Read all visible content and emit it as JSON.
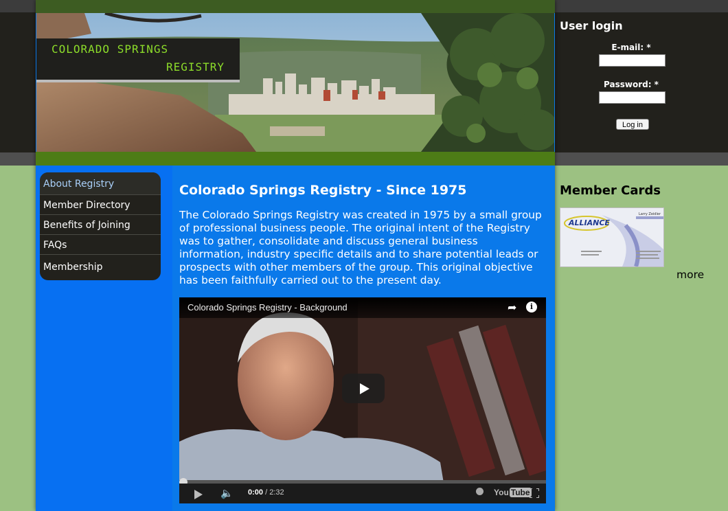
{
  "header": {
    "logo_line1": "COLORADO SPRINGS",
    "logo_line2": "REGISTRY"
  },
  "nav": {
    "items": [
      {
        "label": "About Registry",
        "active": true
      },
      {
        "label": "Member Directory",
        "active": false
      },
      {
        "label": "Benefits of Joining",
        "active": false
      },
      {
        "label": "FAQs",
        "active": false
      },
      {
        "label": "Membership",
        "active": false
      }
    ]
  },
  "main": {
    "title": "Colorado Springs Registry - Since 1975",
    "intro": "The Colorado Springs Registry was created in 1975 by a small group of professional business people. The original intent of the Registry was to gather, consolidate and discuss general business information, industry specific details and to share potential leads or prospects with other members of the group. This original objective has been faithfully carried out to the present day."
  },
  "video": {
    "title": "Colorado Springs Registry - Background",
    "current_time": "0:00",
    "duration": "/ 2:32",
    "progress": 0,
    "brand": "You",
    "brand_tube": "Tube"
  },
  "login": {
    "title": "User login",
    "email_label": "E-mail: *",
    "email_value": "",
    "password_label": "Password: *",
    "password_value": "",
    "button": "Log in"
  },
  "member_cards": {
    "title": "Member Cards",
    "card_brand": "ALLIANCE",
    "card_name": "Larry Zeidler",
    "more": "more"
  },
  "colors": {
    "page_blue": "#0a79ea",
    "logo_green": "#8ddd2a",
    "sidebar_green": "#9cc182",
    "dark": "#22211c"
  }
}
